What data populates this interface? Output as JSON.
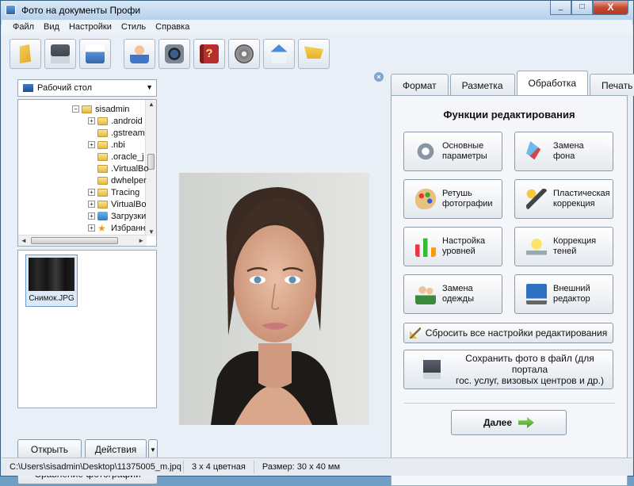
{
  "window": {
    "title": "Фото на документы Профи",
    "minimize": "_",
    "maximize": "□",
    "close": "X"
  },
  "menu": [
    "Файл",
    "Вид",
    "Настройки",
    "Стиль",
    "Справка"
  ],
  "toolbar": {
    "icons": [
      "open-folder-icon",
      "save-icon",
      "print-icon",
      "person-icon",
      "camera-icon",
      "help-book-icon",
      "film-reel-icon",
      "house-icon",
      "cart-icon"
    ]
  },
  "explorer": {
    "location": "Рабочий стол",
    "tree": [
      {
        "label": "sisadmin",
        "expander": "−",
        "icon": "folder"
      },
      {
        "label": ".android",
        "expander": "+",
        "icon": "folder"
      },
      {
        "label": ".gstream",
        "expander": "",
        "icon": "folder"
      },
      {
        "label": ".nbi",
        "expander": "+",
        "icon": "folder"
      },
      {
        "label": ".oracle_j",
        "expander": "",
        "icon": "folder"
      },
      {
        "label": ".VirtualBo",
        "expander": "",
        "icon": "folder"
      },
      {
        "label": "dwhelper",
        "expander": "",
        "icon": "folder"
      },
      {
        "label": "Tracing",
        "expander": "+",
        "icon": "folder"
      },
      {
        "label": "VirtualBo",
        "expander": "+",
        "icon": "folder"
      },
      {
        "label": "Загрузки",
        "expander": "+",
        "icon": "download"
      },
      {
        "label": "Избранн",
        "expander": "+",
        "icon": "favorite"
      }
    ],
    "thumbnail_caption": "Снимок.JPG",
    "open_button": "Открыть",
    "actions_button": "Действия",
    "compare_button": "Сравнение фотографий"
  },
  "tabs": [
    {
      "label": "Формат",
      "active": false
    },
    {
      "label": "Разметка",
      "active": false
    },
    {
      "label": "Обработка",
      "active": true
    },
    {
      "label": "Печать",
      "active": false
    }
  ],
  "panel": {
    "title": "Функции редактирования",
    "functions": [
      {
        "line1": "Основные",
        "line2": "параметры",
        "icon": "gears-icon"
      },
      {
        "line1": "Замена",
        "line2": "фона",
        "icon": "paint-bucket-icon"
      },
      {
        "line1": "Ретушь",
        "line2": "фотографии",
        "icon": "palette-icon"
      },
      {
        "line1": "Пластическая",
        "line2": "коррекция",
        "icon": "magic-wand-icon"
      },
      {
        "line1": "Настройка",
        "line2": "уровней",
        "icon": "levels-bars-icon"
      },
      {
        "line1": "Коррекция",
        "line2": "теней",
        "icon": "lightbulb-icon"
      },
      {
        "line1": "Замена",
        "line2": "одежды",
        "icon": "people-icon"
      },
      {
        "line1": "Внешний",
        "line2": "редактор",
        "icon": "monitor-icon"
      }
    ],
    "reset_button": "Сбросить все настройки редактирования",
    "save_line1": "Сохранить фото в файл (для портала",
    "save_line2": "гос. услуг, визовых центров и др.)",
    "next_button": "Далее"
  },
  "status": {
    "path": "C:\\Users\\sisadmin\\Desktop\\11375005_m.jpq",
    "format": "3 x 4 цветная",
    "size": "Размер: 30 x 40 мм"
  }
}
